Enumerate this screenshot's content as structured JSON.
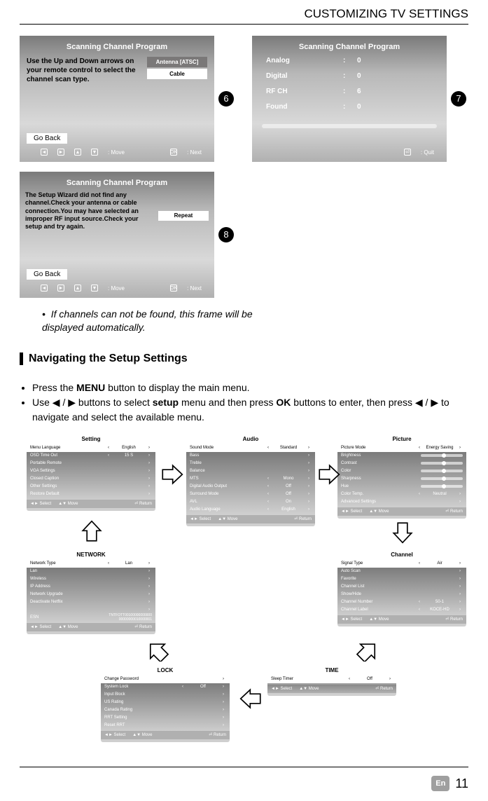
{
  "header": "CUSTOMIZING TV SETTINGS",
  "thumb6": {
    "title": "Scanning Channel Program",
    "instr": "Use the Up and Down arrows on your remote control to select the channel scan type.",
    "opt1": "Antenna [ATSC]",
    "opt2": "Cable",
    "goback": "Go Back",
    "hint_move": ":  Move",
    "hint_next": ":  Next"
  },
  "thumb7": {
    "title": "Scanning Channel Program",
    "rows": [
      {
        "k": "Analog",
        "v": "0"
      },
      {
        "k": "Digital",
        "v": "0"
      },
      {
        "k": "RF CH",
        "v": "6"
      },
      {
        "k": "Found",
        "v": "0"
      }
    ],
    "hint_quit": ":  Quit"
  },
  "thumb8": {
    "title": "Scanning Channel Program",
    "instr": "The Setup Wizard did not find any channel.Check your antenna or cable connection.You may have selected an improper RF input source.Check your setup and try again.",
    "repeat": "Repeat",
    "goback": "Go Back",
    "hint_move": ":  Move",
    "hint_next": ":  Next"
  },
  "callouts": {
    "c6": "6",
    "c7": "7",
    "c8": "8"
  },
  "note_bullet": "•",
  "note": "If channels can not be found, this frame will be displayed automatically.",
  "section": "Navigating the Setup Settings",
  "instr1a": "Press the ",
  "instr1b": "MENU",
  "instr1c": " button to display the main menu.",
  "instr2a": "Use ",
  "instr2b": " / ",
  "instr2c": " buttons to select ",
  "instr2d": "setup",
  "instr2e": " menu and then press ",
  "instr2f": "OK",
  "instr2g": " buttons to enter, then press ",
  "instr2h": " / ",
  "instr2i": " to navigate and select the available menu.",
  "panels": {
    "setting": {
      "title": "Setting",
      "rows": [
        {
          "lab": "Menu Language",
          "val": "English",
          "sel": true
        },
        {
          "lab": "OSD Time Out",
          "val": "15 S"
        },
        {
          "lab": "Portable Remote"
        },
        {
          "lab": "VGA Settings"
        },
        {
          "lab": "Closed Caption"
        },
        {
          "lab": "Other Settings"
        },
        {
          "lab": "Restore Default"
        }
      ]
    },
    "audio": {
      "title": "Audio",
      "rows": [
        {
          "lab": "Sound Mode",
          "val": "Standard",
          "sel": true
        },
        {
          "lab": "Bass"
        },
        {
          "lab": "Treble"
        },
        {
          "lab": "Balance"
        },
        {
          "lab": "MTS",
          "val": "Mono"
        },
        {
          "lab": "Digital Audio Output",
          "val": "Off"
        },
        {
          "lab": "Surround Mode",
          "val": "Off"
        },
        {
          "lab": "AVL",
          "val": "On"
        },
        {
          "lab": "Audio Language",
          "val": "English"
        }
      ]
    },
    "picture": {
      "title": "Picture",
      "rows": [
        {
          "lab": "Picture Mode",
          "val": "Energy Saving",
          "sel": true
        },
        {
          "lab": "Brightness",
          "slider": true
        },
        {
          "lab": "Contrast",
          "slider": true
        },
        {
          "lab": "Color",
          "slider": true
        },
        {
          "lab": "Sharpness",
          "slider": true
        },
        {
          "lab": "Hue",
          "slider": true
        },
        {
          "lab": "Color Temp.",
          "val": "Neutral"
        },
        {
          "lab": "Advanced Settings"
        }
      ]
    },
    "network": {
      "title": "NETWORK",
      "rows": [
        {
          "lab": "Network Type",
          "val": "Lan",
          "sel": true
        },
        {
          "lab": "Lan"
        },
        {
          "lab": "Wireless"
        },
        {
          "lab": "IP Address"
        },
        {
          "lab": "Network Upgrade"
        },
        {
          "lab": "Deactivate Netflix"
        },
        {
          "lab": " "
        },
        {
          "lab": "ESN",
          "val2": "TNTFOTT00100000000000\n00000000010000001"
        }
      ]
    },
    "channel": {
      "title": "Channel",
      "rows": [
        {
          "lab": "Signal Type",
          "val": "Air",
          "sel": true
        },
        {
          "lab": "Auto Scan"
        },
        {
          "lab": "Favorite"
        },
        {
          "lab": "Channel List"
        },
        {
          "lab": "Show/Hide"
        },
        {
          "lab": "Channel Number",
          "val": "50-1"
        },
        {
          "lab": "Channel Label",
          "val": "KOCE-HD"
        }
      ]
    },
    "lock": {
      "title": "LOCK",
      "rows": [
        {
          "lab": "Change Password",
          "sel": true
        },
        {
          "lab": "System Lock",
          "val": "Off"
        },
        {
          "lab": "Input Block"
        },
        {
          "lab": "US Rating"
        },
        {
          "lab": "Canada Rating"
        },
        {
          "lab": "RRT Setting"
        },
        {
          "lab": "Reset RRT"
        }
      ]
    },
    "time": {
      "title": "TIME",
      "rows": [
        {
          "lab": "Sleep Timer",
          "val": "Off",
          "sel": true
        }
      ]
    },
    "footer": {
      "select": "Select",
      "move": "Move",
      "return": "Return"
    }
  },
  "footer": {
    "en": "En",
    "num": "11"
  }
}
